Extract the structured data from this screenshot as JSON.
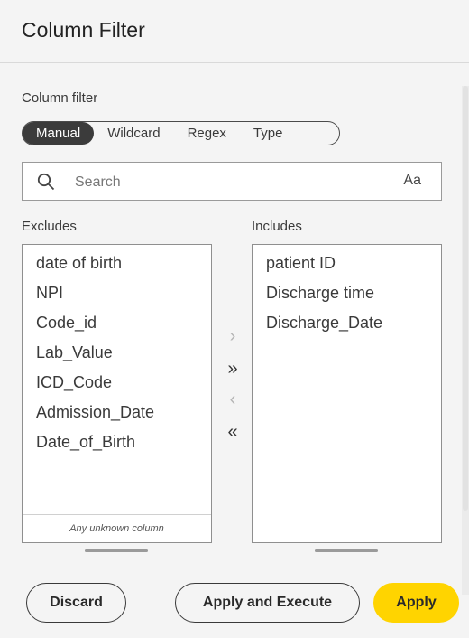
{
  "header": {
    "title": "Column Filter"
  },
  "filter": {
    "section_label": "Column filter",
    "modes": [
      "Manual",
      "Wildcard",
      "Regex",
      "Type"
    ],
    "active_mode": "Manual"
  },
  "search": {
    "placeholder": "Search",
    "case_toggle": "Aa",
    "icon": "search-icon"
  },
  "excludes": {
    "label": "Excludes",
    "items": [
      "date of birth",
      "NPI",
      "Code_id",
      "Lab_Value",
      "ICD_Code",
      "Admission_Date",
      "Date_of_Birth"
    ],
    "unknown_label": "Any unknown column"
  },
  "includes": {
    "label": "Includes",
    "items": [
      "patient ID",
      "Discharge time",
      "Discharge_Date"
    ]
  },
  "transfer": {
    "move_right": "›",
    "move_all_right": "»",
    "move_left": "‹",
    "move_all_left": "«"
  },
  "footer": {
    "discard": "Discard",
    "apply_execute": "Apply and Execute",
    "apply": "Apply"
  },
  "colors": {
    "accent": "#ffd400",
    "active_segment": "#3b3b3b"
  }
}
